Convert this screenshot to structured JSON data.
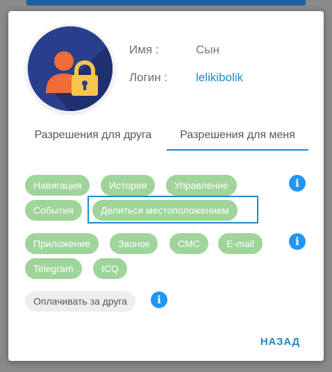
{
  "profile": {
    "name_label": "Имя :",
    "name_value": "Сын",
    "login_label": "Логин :",
    "login_value": "lelikibolik"
  },
  "tabs": [
    {
      "label": "Разрешения для друга",
      "active": false
    },
    {
      "label": "Разрешения для меня",
      "active": true
    }
  ],
  "chips_group1": [
    {
      "label": "Навигация"
    },
    {
      "label": "История"
    },
    {
      "label": "Управление"
    },
    {
      "label": "События"
    },
    {
      "label": "Делиться местоположением"
    }
  ],
  "chips_group2": [
    {
      "label": "Приложение"
    },
    {
      "label": "Звонок"
    },
    {
      "label": "СМС"
    },
    {
      "label": "E-mail"
    },
    {
      "label": "Telegram"
    },
    {
      "label": "ICQ"
    }
  ],
  "pay_chip": {
    "label": "Оплачивать за друга"
  },
  "info_icon_glyph": "i",
  "back_button": "НАЗАД",
  "colors": {
    "accent": "#1e88c8",
    "chip_green": "#9fd49a",
    "info_blue": "#2196f3",
    "avatar_bg": "#2a3f8c"
  }
}
